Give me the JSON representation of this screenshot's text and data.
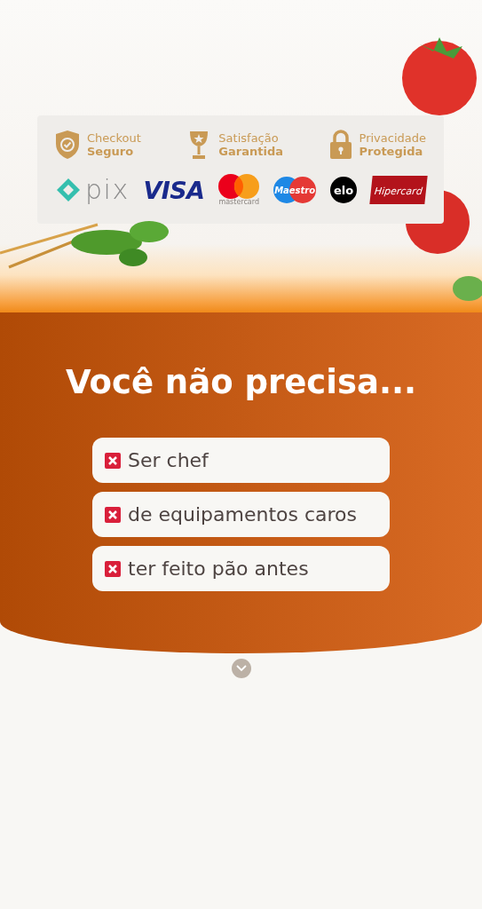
{
  "trust_badges": [
    {
      "kind": "shield",
      "line1": "Checkout",
      "line2": "Seguro"
    },
    {
      "kind": "trophy",
      "line1": "Satisfação",
      "line2": "Garantida"
    },
    {
      "kind": "lock",
      "line1": "Privacidade",
      "line2": "Protegida"
    }
  ],
  "payment_logos": [
    {
      "kind": "pix",
      "label": "pix"
    },
    {
      "kind": "visa",
      "label": "VISA"
    },
    {
      "kind": "mastercard",
      "label": "mastercard"
    },
    {
      "kind": "maestro",
      "label": "Maestro"
    },
    {
      "kind": "elo",
      "label": "elo"
    },
    {
      "kind": "hipercard",
      "label": "Hipercard"
    }
  ],
  "headline": "Você não precisa...",
  "items": [
    {
      "text": "Ser chef"
    },
    {
      "text": "de equipamentos caros"
    },
    {
      "text": "ter feito pão antes"
    }
  ]
}
